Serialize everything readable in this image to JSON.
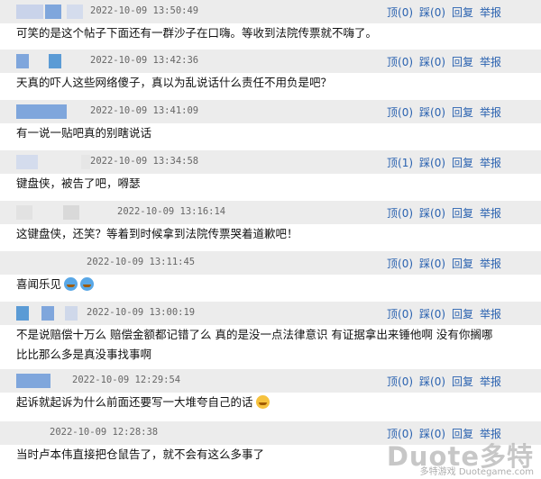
{
  "action_labels": {
    "top": "顶",
    "step": "踩",
    "reply": "回复",
    "report": "举报"
  },
  "comments": [
    {
      "timestamp": "2022-10-09 13:50:49",
      "top_count": "(0)",
      "step_count": "(0)",
      "text": "可笑的是这个帖子下面还有一群沙子在口嗨。等收到法院传票就不嗨了。",
      "emoji": []
    },
    {
      "timestamp": "2022-10-09 13:42:36",
      "top_count": "(0)",
      "step_count": "(0)",
      "text": "天真的吓人这些网络傻子，真以为乱说话什么责任不用负是吧？",
      "emoji": []
    },
    {
      "timestamp": "2022-10-09 13:41:09",
      "top_count": "(0)",
      "step_count": "(0)",
      "text": "有一说一贴吧真的别瞎说话",
      "emoji": []
    },
    {
      "timestamp": "2022-10-09 13:34:58",
      "top_count": "(1)",
      "step_count": "(0)",
      "text": "键盘侠，被告了吧，嘚瑟",
      "emoji": []
    },
    {
      "timestamp": "2022-10-09 13:16:14",
      "top_count": "(0)",
      "step_count": "(0)",
      "text": "这键盘侠，还笑？等着到时候拿到法院传票哭着道歉吧！",
      "emoji": []
    },
    {
      "timestamp": "2022-10-09 13:11:45",
      "top_count": "(0)",
      "step_count": "(0)",
      "text": "喜闻乐见",
      "emoji": [
        "laughing-emoji",
        "laughing-emoji"
      ]
    },
    {
      "timestamp": "2022-10-09 13:00:19",
      "top_count": "(0)",
      "step_count": "(0)",
      "text": "不是说赔偿十万么  赔偿金额都记错了么  真的是没一点法律意识  有证据拿出来锤他啊  没有你搁哪",
      "text2": "比比那么多是真没事找事啊",
      "emoji": []
    },
    {
      "timestamp": "2022-10-09 12:29:54",
      "top_count": "(0)",
      "step_count": "(0)",
      "text": "起诉就起诉为什么前面还要写一大堆夸自己的话",
      "emoji": [
        "grin-emoji"
      ]
    },
    {
      "timestamp": "2022-10-09 12:28:38",
      "top_count": "(0)",
      "step_count": "(0)",
      "text": "当时卢本伟直接把仓鼠告了，就不会有这么多事了",
      "emoji": []
    }
  ],
  "watermark": {
    "logo_text": "Duote多特",
    "sub_text": "多特游戏 Duotegame.com"
  },
  "colors": {
    "header_bg": "#ececec",
    "action_link": "#2a62b0",
    "timestamp": "#666666",
    "avatar_blue": "#5b9bd5"
  }
}
